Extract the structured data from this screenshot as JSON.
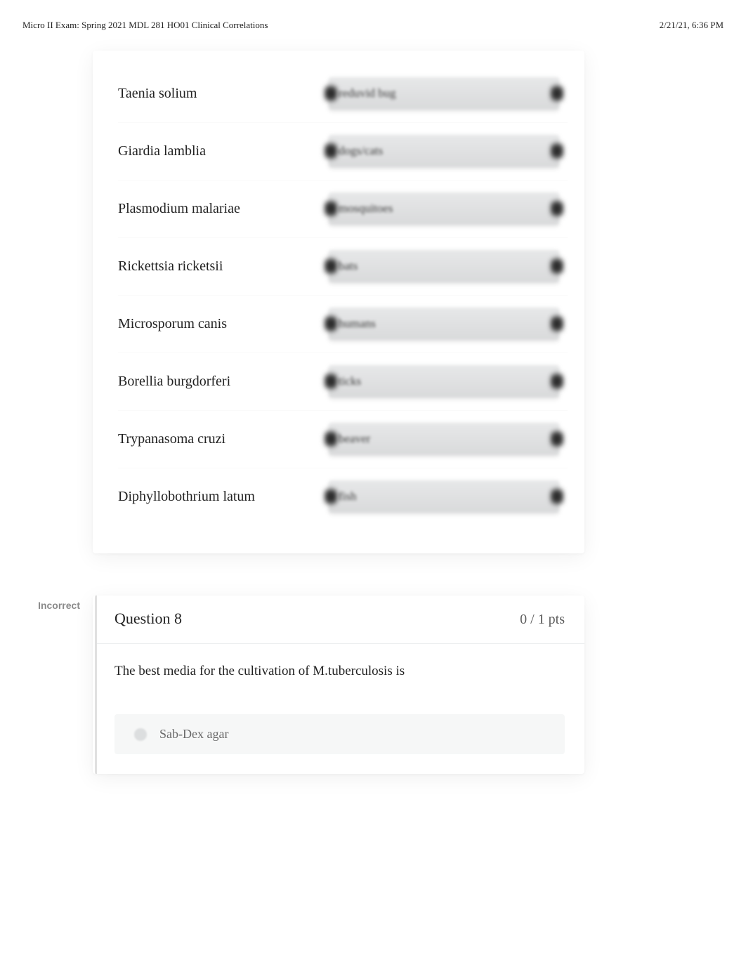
{
  "header": {
    "left": "Micro II Exam: Spring 2021 MDL 281 HO01 Clinical Correlations",
    "right": "2/21/21, 6:36 PM"
  },
  "matching": {
    "rows": [
      {
        "term": "Taenia solium",
        "answer": "reduvid bug"
      },
      {
        "term": "Giardia lamblia",
        "answer": "dogs/cats"
      },
      {
        "term": "Plasmodium malariae",
        "answer": "mosquitoes"
      },
      {
        "term": "Rickettsia ricketsii",
        "answer": "bats"
      },
      {
        "term": "Microsporum canis",
        "answer": "humans"
      },
      {
        "term": "Borellia burgdorferi",
        "answer": "ticks"
      },
      {
        "term": "Trypanasoma cruzi",
        "answer": "beaver"
      },
      {
        "term": "Diphyllobothrium latum",
        "answer": "fish"
      }
    ]
  },
  "question8": {
    "status": "Incorrect",
    "title": "Question 8",
    "points": "0 / 1 pts",
    "prompt": "The best media for the cultivation of M.tuberculosis is",
    "option": "Sab-Dex agar"
  }
}
